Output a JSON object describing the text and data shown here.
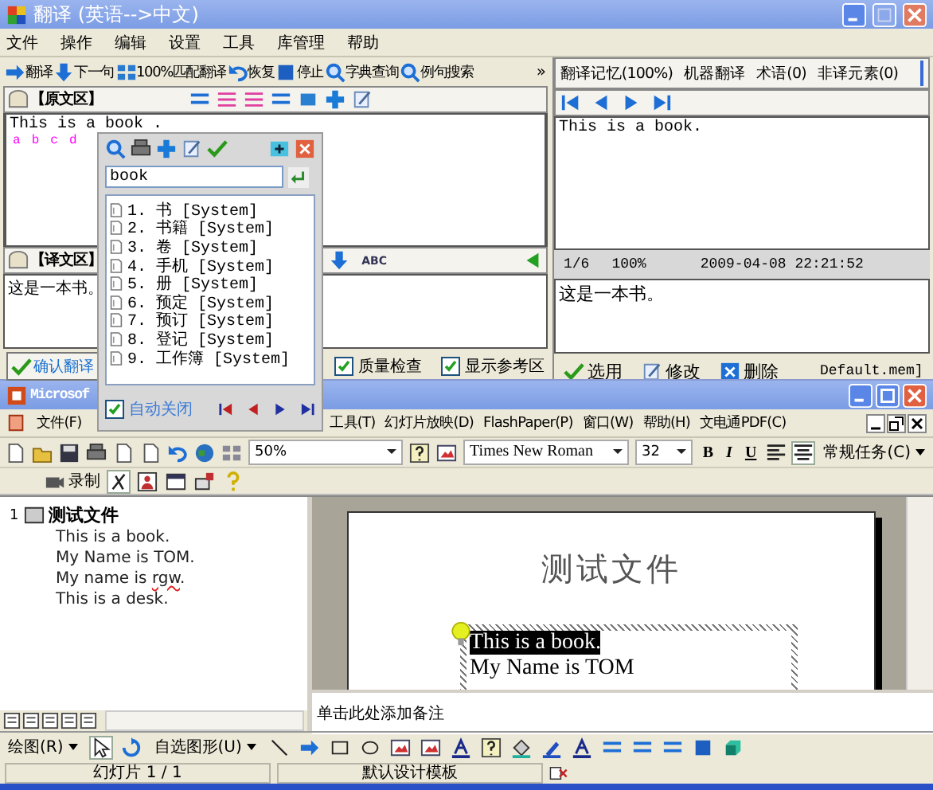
{
  "translator": {
    "title": "翻译 (英语-->中文)",
    "menu": [
      "文件",
      "操作",
      "编辑",
      "设置",
      "工具",
      "库管理",
      "帮助"
    ],
    "toolbar": [
      "翻译",
      "下一句",
      "100%匹配翻译",
      "恢复",
      "停止",
      "字典查询",
      "例句搜索"
    ],
    "toolbar_more": "»",
    "source": {
      "header": "【原文区】",
      "text": "This is a book .",
      "markers": [
        "a",
        "b",
        "c",
        "d"
      ]
    },
    "target": {
      "header": "【译文区】",
      "tool_text": "ABC",
      "text": "这是一本书。"
    },
    "confirm_button": "确认翻译",
    "options": [
      {
        "label": "质量检查",
        "checked": true
      },
      {
        "label": "显示参考区",
        "checked": true
      }
    ],
    "reference": {
      "tabs": [
        "翻译记忆(100%)",
        "机器翻译",
        "术语(0)",
        "非译元素(0)"
      ],
      "source_text": "This is a book.",
      "status": [
        "1/6",
        "100%",
        "2009-04-08 22:21:52"
      ],
      "target_text": "这是一本书。",
      "actions": [
        "选用",
        "修改",
        "删除"
      ],
      "memory_file": "Default.mem]"
    }
  },
  "lookup": {
    "query": "book",
    "results": [
      {
        "number": "1.",
        "term": "书",
        "origin": "[System]"
      },
      {
        "number": "2.",
        "term": "书籍",
        "origin": "[System]"
      },
      {
        "number": "3.",
        "term": "卷",
        "origin": "[System]"
      },
      {
        "number": "4.",
        "term": "手机",
        "origin": "[System]"
      },
      {
        "number": "5.",
        "term": "册",
        "origin": "[System]"
      },
      {
        "number": "6.",
        "term": "预定",
        "origin": "[System]"
      },
      {
        "number": "7.",
        "term": "预订",
        "origin": "[System]"
      },
      {
        "number": "8.",
        "term": "登记",
        "origin": "[System]"
      },
      {
        "number": "9.",
        "term": "工作簿",
        "origin": "[System]"
      }
    ],
    "auto_close": {
      "label": "自动关闭",
      "checked": true
    }
  },
  "presentation": {
    "title": "Microsof",
    "menu": [
      "文件(F)",
      "工具(T)",
      "幻灯片放映(D)",
      "FlashPaper(P)",
      "窗口(W)",
      "帮助(H)",
      "文电通PDF(C)"
    ],
    "zoom": "50%",
    "font": "Times New Roman",
    "font_size": "32",
    "format_buttons": [
      "B",
      "I",
      "U"
    ],
    "tasks": "常规任务(C)",
    "record": "录制",
    "outline": {
      "number": "1",
      "title": "测试文件",
      "lines": [
        {
          "parts": [
            {
              "text": "This is a book.",
              "misspelled": false
            }
          ]
        },
        {
          "parts": [
            {
              "text": "My Name is TOM.",
              "misspelled": false
            }
          ]
        },
        {
          "parts": [
            {
              "text": "My name is ",
              "misspelled": false
            },
            {
              "text": "rgw",
              "misspelled": true
            },
            {
              "text": ".",
              "misspelled": false
            }
          ]
        },
        {
          "parts": [
            {
              "text": "This is a desk.",
              "misspelled": false
            }
          ]
        }
      ]
    },
    "slide": {
      "title": "测试文件",
      "body": [
        {
          "text": "This is a book.",
          "selected": true
        },
        {
          "text": "My Name is TOM",
          "selected": false
        }
      ]
    },
    "notes": "单击此处添加备注",
    "draw_menu": "绘图(R)",
    "autoshapes_menu": "自选图形(U)",
    "status": [
      "幻灯片 1 / 1",
      "默认设计模板"
    ]
  }
}
